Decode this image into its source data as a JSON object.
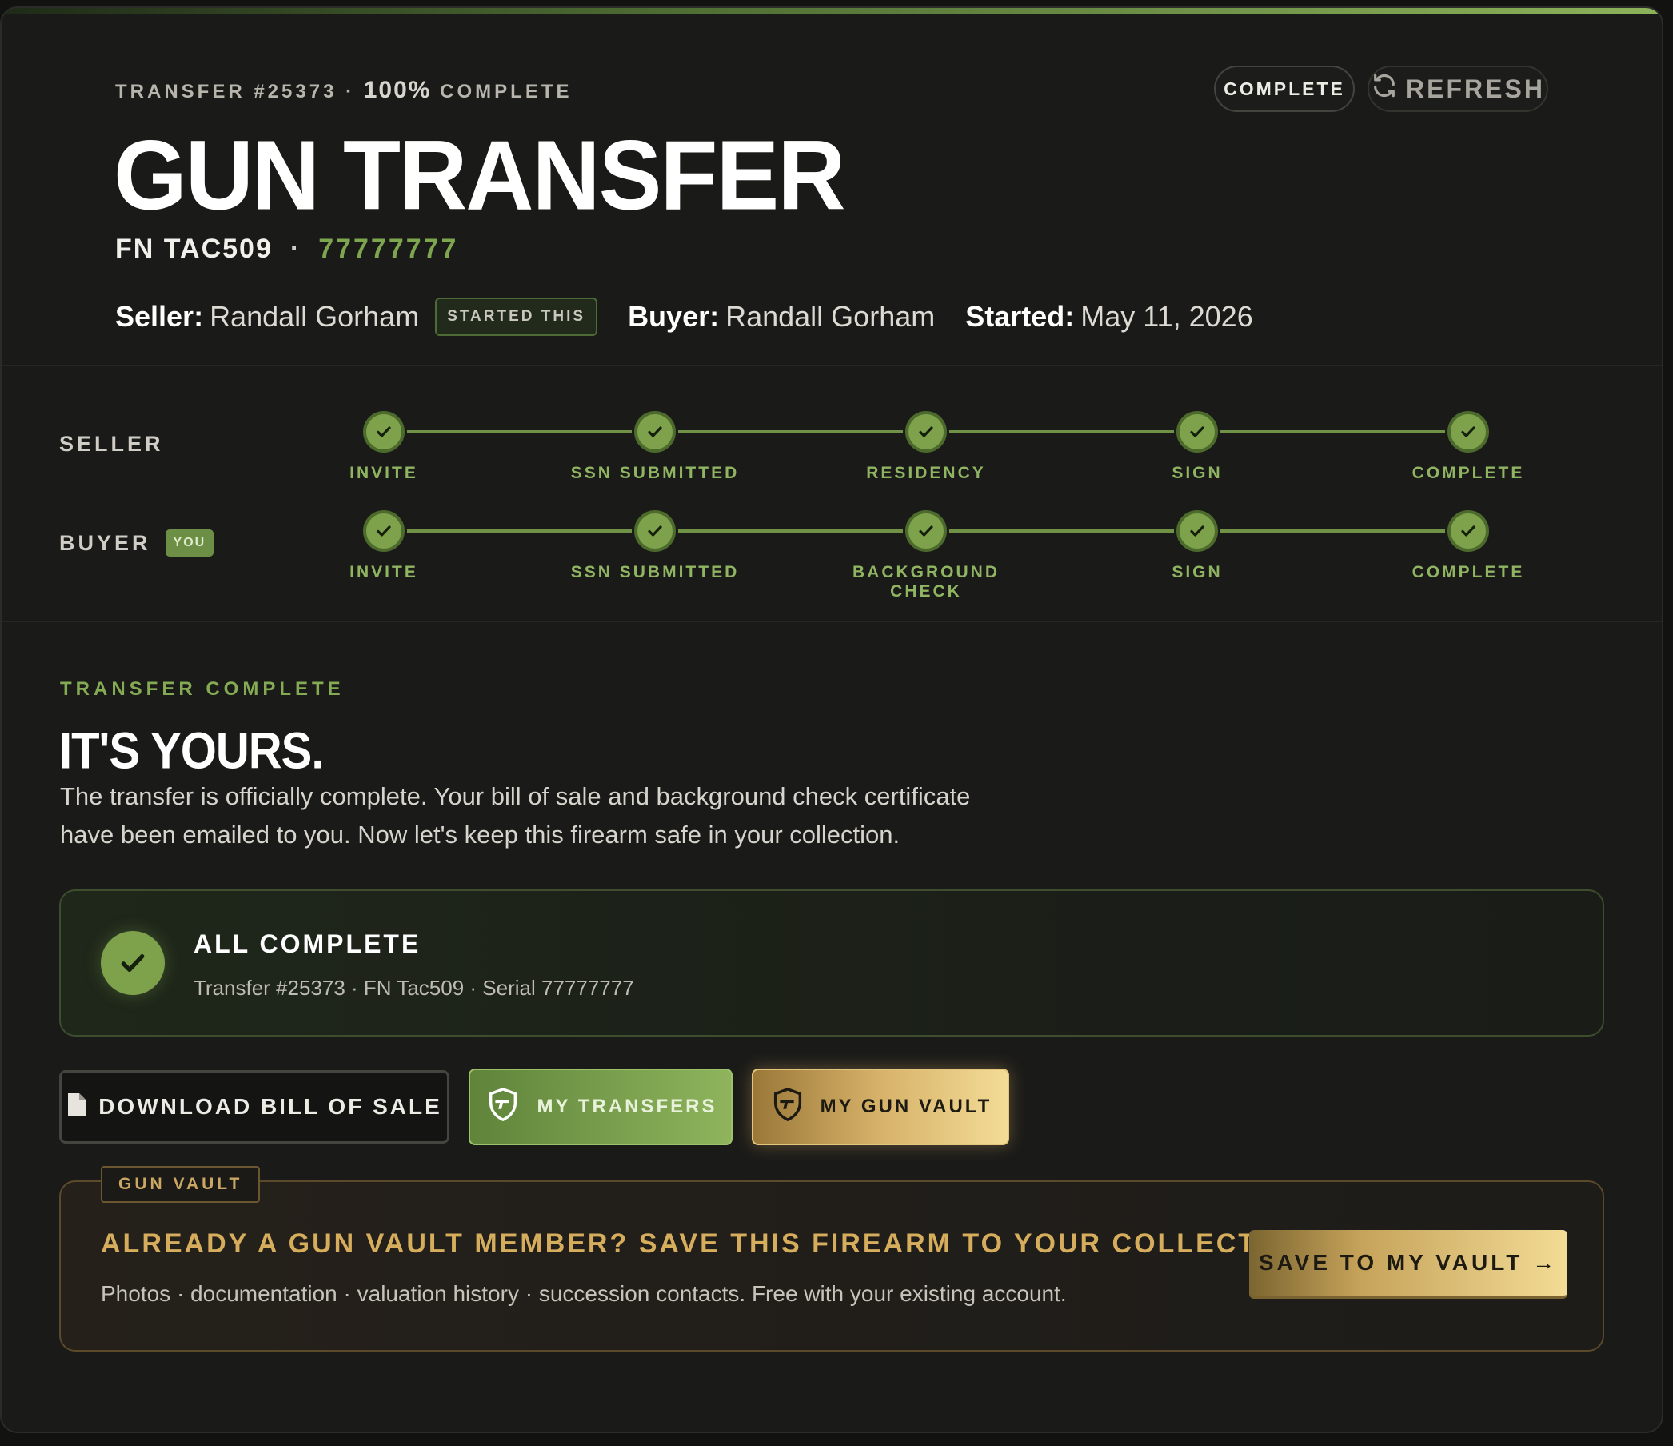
{
  "header": {
    "eyebrow_prefix": "TRANSFER #25373 ·",
    "eyebrow_percent": "100%",
    "eyebrow_suffix": "COMPLETE",
    "title": "GUN TRANSFER",
    "model": "FN TAC509",
    "separator": "·",
    "serial": "77777777",
    "seller_label": "Seller:",
    "seller_name": "Randall Gorham",
    "started_badge": "STARTED THIS",
    "buyer_label": "Buyer:",
    "buyer_name": "Randall Gorham",
    "started_label": "Started:",
    "started_date": "May 11, 2026",
    "status_pill": "COMPLETE",
    "refresh_label": "REFRESH"
  },
  "progress": {
    "seller": {
      "label": "SELLER",
      "steps": [
        "INVITE",
        "SSN SUBMITTED",
        "RESIDENCY",
        "SIGN",
        "COMPLETE"
      ]
    },
    "buyer": {
      "label": "BUYER",
      "badge": "YOU",
      "steps": [
        "INVITE",
        "SSN SUBMITTED",
        "BACKGROUND CHECK",
        "SIGN",
        "COMPLETE"
      ]
    }
  },
  "complete": {
    "kicker": "TRANSFER COMPLETE",
    "headline": "IT'S YOURS.",
    "paragraph_line1": "The transfer is officially complete. Your bill of sale and background check certificate",
    "paragraph_line2": "have been emailed to you. Now let's keep this firearm safe in your collection.",
    "card_title": "ALL COMPLETE",
    "card_subtitle": "Transfer #25373 · FN Tac509 · Serial 77777777"
  },
  "actions": {
    "download": "DOWNLOAD BILL OF SALE",
    "transfers": "MY TRANSFERS",
    "vault": "MY GUN VAULT"
  },
  "vault_promo": {
    "tag": "GUN VAULT",
    "title": "ALREADY A GUN VAULT MEMBER? SAVE THIS FIREARM TO YOUR COLLECTION",
    "subtitle": "Photos · documentation · valuation history · succession contacts. Free with your existing account.",
    "button": "SAVE TO MY VAULT →"
  },
  "colors": {
    "accent_green": "#7ea24c",
    "accent_gold": "#d5ad5c",
    "background": "#1a1a18"
  }
}
